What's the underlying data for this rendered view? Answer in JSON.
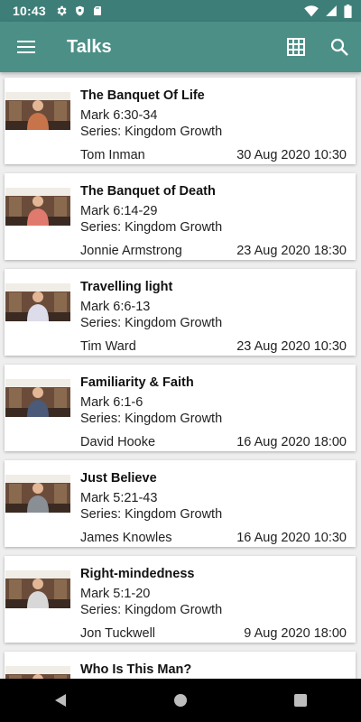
{
  "status_bar": {
    "time": "10:43",
    "left_icons": [
      "gear-icon",
      "shield-icon",
      "sd-card-icon"
    ],
    "right_icons": [
      "wifi-icon",
      "signal-icon",
      "battery-icon"
    ]
  },
  "app_bar": {
    "title": "Talks",
    "menu_icon": "hamburger-menu-icon",
    "actions": [
      "grid-view-icon",
      "search-icon"
    ],
    "color": "#4c8f87"
  },
  "talks": [
    {
      "title": "The Banquet Of Life",
      "passage": "Mark 6:30-34",
      "series": "Series: Kingdom Growth",
      "speaker": "Tom Inman",
      "date": "30 Aug 2020 10:30",
      "thumb_shirt": "#c8744a"
    },
    {
      "title": "The Banquet of Death",
      "passage": "Mark 6:14-29",
      "series": "Series: Kingdom Growth",
      "speaker": "Jonnie Armstrong",
      "date": "23 Aug 2020 18:30",
      "thumb_shirt": "#e07a6e"
    },
    {
      "title": "Travelling light",
      "passage": "Mark 6:6-13",
      "series": "Series: Kingdom Growth",
      "speaker": "Tim Ward",
      "date": "23 Aug 2020 10:30",
      "thumb_shirt": "#dcdcea"
    },
    {
      "title": "Familiarity & Faith",
      "passage": "Mark 6:1-6",
      "series": "Series: Kingdom Growth",
      "speaker": "David Hooke",
      "date": "16 Aug 2020 18:00",
      "thumb_shirt": "#4a5a78"
    },
    {
      "title": "Just Believe",
      "passage": "Mark 5:21-43",
      "series": "Series: Kingdom Growth",
      "speaker": "James Knowles",
      "date": "16 Aug 2020 10:30",
      "thumb_shirt": "#8a8f96"
    },
    {
      "title": "Right-mindedness",
      "passage": "Mark 5:1-20",
      "series": "Series: Kingdom Growth",
      "speaker": "Jon Tuckwell",
      "date": "9 Aug 2020 18:00",
      "thumb_shirt": "#d8d8d8"
    },
    {
      "title": "Who Is This Man?",
      "passage": "",
      "series": "",
      "speaker": "",
      "date": "",
      "thumb_shirt": "#7a6a5a"
    }
  ],
  "nav_bar": {
    "buttons": [
      "back-icon",
      "home-icon",
      "recents-icon"
    ]
  }
}
